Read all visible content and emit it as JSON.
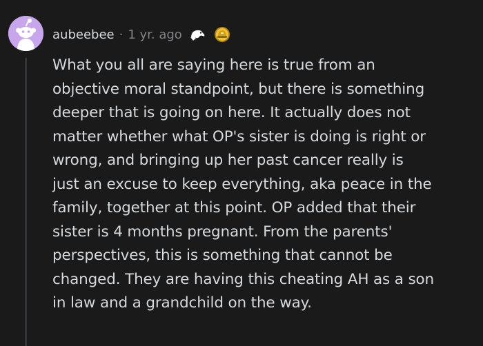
{
  "comment": {
    "username": "aubeebee",
    "separator": "·",
    "timestamp": "1 yr. ago",
    "awards": [
      "wholesome-seal-award-icon",
      "gold-helmet-award-icon"
    ],
    "avatar_color": "#c8a6ec",
    "body_lines": [
      "What you all are saying here is true from an",
      "objective moral standpoint, but there is something",
      "deeper that is going on here. It actually does not",
      "matter whether what OP's sister is doing is right or",
      "wrong, and bringing up her past cancer really is",
      "just an excuse to keep everything, aka peace in the",
      "family, together at this point. OP added that their",
      "sister is 4 months pregnant. From the parents'",
      "perspectives, this is something that cannot be",
      "changed. They are having this cheating AH as a son",
      "in law and a grandchild on the way."
    ]
  },
  "colors": {
    "background": "#1a1a1b",
    "text": "#d7dadc",
    "muted": "#818384",
    "thread_line": "#343536"
  }
}
